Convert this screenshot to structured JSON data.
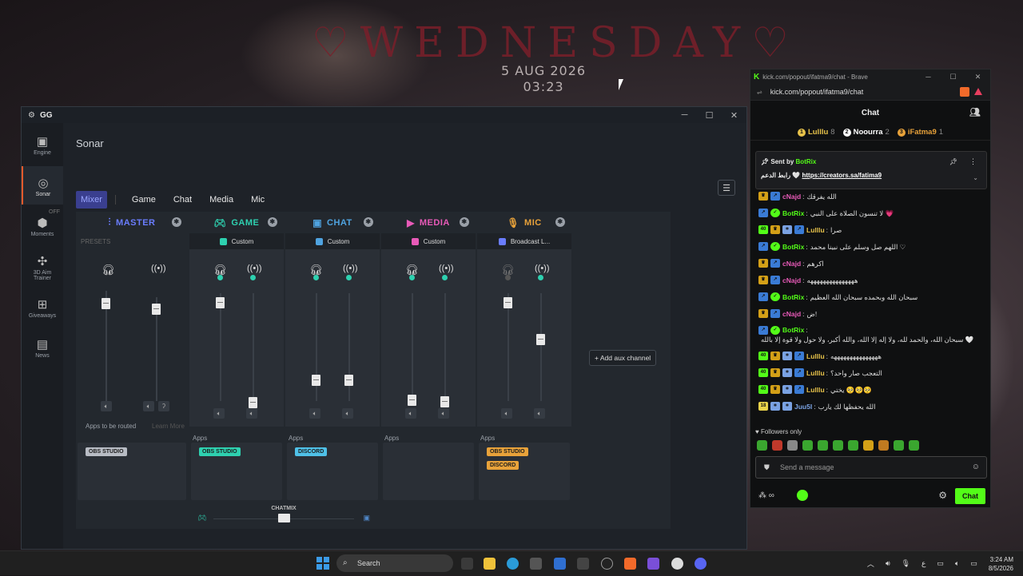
{
  "wallpaper": {
    "title": "♡WEDNESDAY♡",
    "date": "5 AUG 2026",
    "time": "03:23"
  },
  "gg": {
    "app_name": "GG",
    "sidebar": [
      {
        "label": "Engine",
        "icon": "chip-icon"
      },
      {
        "label": "Sonar",
        "icon": "sonar-icon",
        "active": true
      },
      {
        "label": "Moments",
        "icon": "moments-icon",
        "badge": "OFF"
      },
      {
        "label": "3D Aim Trainer",
        "icon": "aim-icon"
      },
      {
        "label": "Giveaways",
        "icon": "gift-icon"
      },
      {
        "label": "News",
        "icon": "news-icon"
      }
    ],
    "page_title": "Sonar",
    "tabs": [
      "Mixer",
      "Game",
      "Chat",
      "Media",
      "Mic"
    ],
    "columns": [
      {
        "name": "MASTER",
        "color": "#6a7dff",
        "sub": "PRESETS",
        "apps_label": "Apps to be routed",
        "learn": "Learn More",
        "chips": [
          {
            "label": "OBS STUDIO",
            "color": "#b8bcc4"
          }
        ]
      },
      {
        "name": "GAME",
        "color": "#2ed1b0",
        "sub": "Custom",
        "apps_label": "Apps",
        "chips": [
          {
            "label": "OBS STUDIO",
            "color": "#2ed1b0"
          }
        ]
      },
      {
        "name": "CHAT",
        "color": "#4fa3e0",
        "sub": "Custom",
        "apps_label": "Apps",
        "chips": [
          {
            "label": "DISCORD",
            "color": "#4fc1e8"
          }
        ]
      },
      {
        "name": "MEDIA",
        "color": "#e85ab8",
        "sub": "Custom",
        "apps_label": "Apps",
        "chips": []
      },
      {
        "name": "MIC",
        "color": "#e8a23a",
        "sub": "Broadcast L...",
        "apps_label": "Apps",
        "chips": [
          {
            "label": "OBS STUDIO",
            "color": "#e8a23a"
          },
          {
            "label": "DISCORD",
            "color": "#e8a23a"
          }
        ]
      }
    ],
    "add_aux": "+ Add aux channel",
    "chatmix": "CHATMIX"
  },
  "kick": {
    "tab_title": "kick.com/popout/ifatma9/chat - Brave",
    "url": "kick.com/popout/ifatma9/chat",
    "header": "Chat",
    "leaders": [
      {
        "rank": "1",
        "name": "Lulllu",
        "count": "8",
        "color": "#e8c34a"
      },
      {
        "rank": "2",
        "name": "Noourra",
        "count": "2",
        "color": "#ffffff"
      },
      {
        "rank": "3",
        "name": "iFatma9",
        "count": "1",
        "color": "#e8a23a"
      }
    ],
    "pinned": {
      "sent_by": "Sent by",
      "author": "BotRix",
      "text": "رابط الدعم",
      "link": "https://creators.sa/fatima9"
    },
    "messages": [
      {
        "badges": [
          "crown",
          "kick"
        ],
        "user": "cNajd",
        "color": "#e85ab8",
        "text": "الله يفرقك"
      },
      {
        "badges": [
          "kick",
          "v"
        ],
        "user": "BotRix",
        "color": "#53fc18",
        "text": "لا تنسون الصلاة على النبي 💗"
      },
      {
        "badges": [
          "40",
          "crown",
          "sub",
          "kick"
        ],
        "user": "Lulllu",
        "color": "#e8c34a",
        "text": "صرا"
      },
      {
        "badges": [
          "kick",
          "v"
        ],
        "user": "BotRix",
        "color": "#53fc18",
        "text": "اللهم صل وسلم على نبينا محمد ♡"
      },
      {
        "badges": [
          "crown",
          "kick"
        ],
        "user": "cNajd",
        "color": "#e85ab8",
        "text": "اكرهم"
      },
      {
        "badges": [
          "crown",
          "kick"
        ],
        "user": "cNajd",
        "color": "#e85ab8",
        "text": "هههههههههههههههه"
      },
      {
        "badges": [
          "kick",
          "v"
        ],
        "user": "BotRix",
        "color": "#53fc18",
        "text": "سبحان الله وبحمده سبحان الله العظيم"
      },
      {
        "badges": [
          "crown",
          "kick"
        ],
        "user": "cNajd",
        "color": "#e85ab8",
        "text": "ض!"
      },
      {
        "badges": [
          "kick",
          "v"
        ],
        "user": "BotRix",
        "color": "#53fc18",
        "text": "سبحان الله، والحمد لله، ولا إله إلا الله، والله أكبر، ولا حول ولا قوة إلا بالله 🤍"
      },
      {
        "badges": [
          "40",
          "crown",
          "sub",
          "kick"
        ],
        "user": "Lulllu",
        "color": "#e8c34a",
        "text": "هههههههههههههههه"
      },
      {
        "badges": [
          "40",
          "crown",
          "sub",
          "kick"
        ],
        "user": "Lulllu",
        "color": "#e8c34a",
        "text": "التعجب صار واحد؟"
      },
      {
        "badges": [
          "40",
          "crown",
          "sub",
          "kick"
        ],
        "user": "Lulllu",
        "color": "#e8c34a",
        "text": "يختي 🥺🥺🥺"
      },
      {
        "badges": [
          "18",
          "sub",
          "sub"
        ],
        "user": "Juu5I",
        "color": "#7aa2e3",
        "text": "الله يحفظها لك يارب"
      }
    ],
    "followers_only": "♥ Followers only",
    "send_placeholder": "Send a message",
    "chat_button": "Chat"
  },
  "taskbar": {
    "search": "Search",
    "time": "3:24 AM",
    "date": "8/5/2026",
    "lang": "ع"
  }
}
